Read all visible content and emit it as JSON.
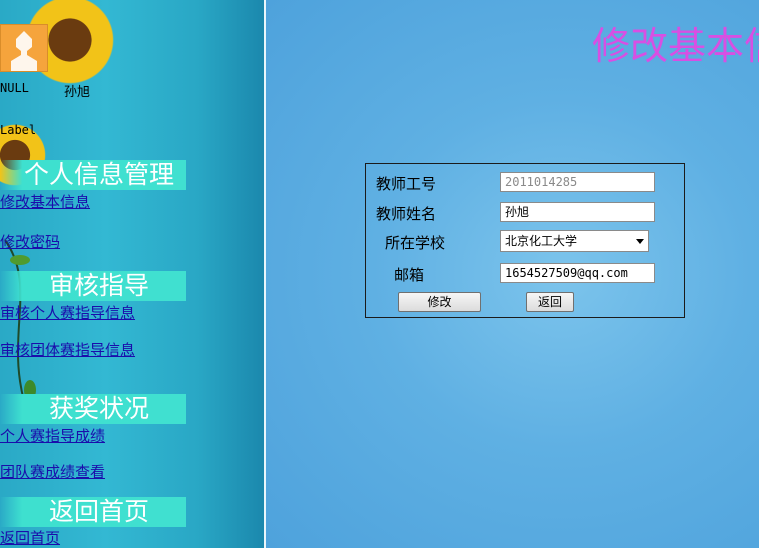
{
  "user": {
    "null_text": "NULL",
    "name": "孙旭",
    "label": "Label"
  },
  "sidebar": {
    "sections": [
      {
        "title": "个人信息管理",
        "links": [
          "修改基本信息",
          "修改密码"
        ]
      },
      {
        "title": "审核指导",
        "links": [
          "审核个人赛指导信息",
          "审核团体赛指导信息"
        ]
      },
      {
        "title": "获奖状况",
        "links": [
          "个人赛指导成绩",
          "团队赛成绩查看"
        ]
      },
      {
        "title": "返回首页",
        "links": [
          "返回首页"
        ]
      }
    ]
  },
  "main": {
    "title": "修改基本信",
    "form": {
      "teacher_id_label": "教师工号",
      "teacher_id_value": "2011014285",
      "teacher_name_label": "教师姓名",
      "teacher_name_value": "孙旭",
      "school_label": "所在学校",
      "school_value": "北京化工大学",
      "email_label": "邮箱",
      "email_value": "1654527509@qq.com",
      "submit_label": "修改",
      "back_label": "返回"
    }
  },
  "colors": {
    "title": "#d84fe3",
    "section_bg": "#40e0d0",
    "link": "#1a0dab"
  }
}
